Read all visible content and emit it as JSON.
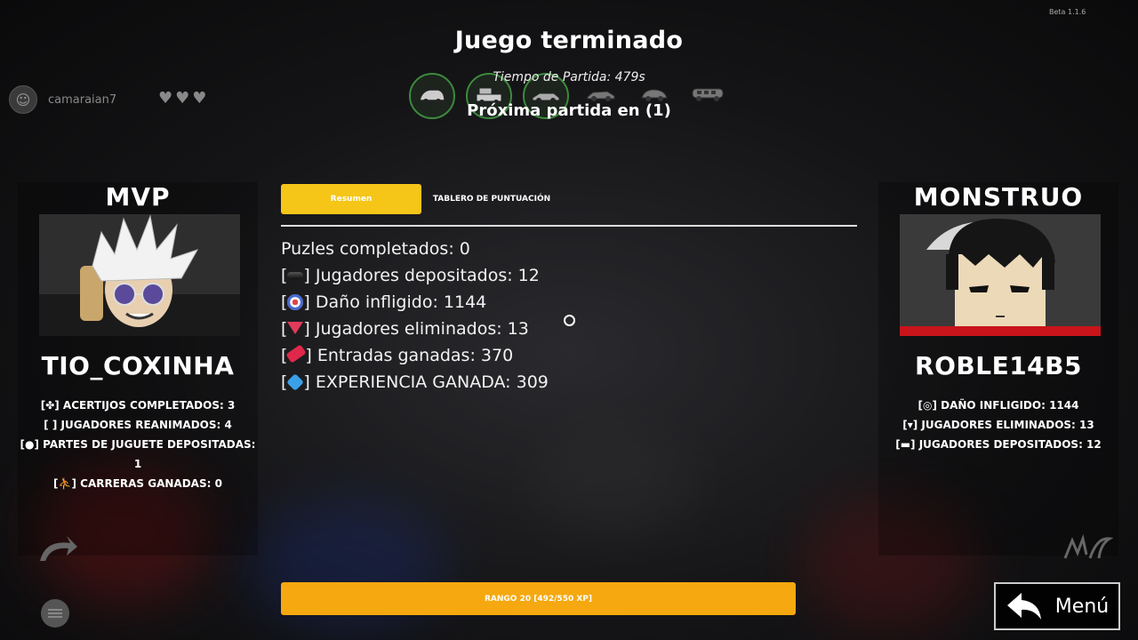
{
  "beta_label": "Beta 1.1.6",
  "title": "Juego terminado",
  "match_time": "Tiempo de Partida: 479s",
  "next_match": "Próxima partida en (1)",
  "user": {
    "name": "camaraian7",
    "lives": 3
  },
  "items": [
    {
      "icon": "toy-car-icon",
      "owned": true
    },
    {
      "icon": "toy-truck-icon",
      "owned": true
    },
    {
      "icon": "toy-racecar-icon",
      "owned": true
    },
    {
      "icon": "toy-sportscar-icon",
      "owned": false
    },
    {
      "icon": "toy-coupe-icon",
      "owned": false
    },
    {
      "icon": "toy-bus-icon",
      "owned": false
    }
  ],
  "mvp": {
    "heading": "MVP",
    "player": "TIO_COXINHA",
    "stats": [
      "[✤] ACERTIJOS COMPLETADOS: 3",
      "[ ] JUGADORES REANIMADOS: 4",
      "[●] PARTES DE JUGUETE DEPOSITADAS: 1",
      "[⛹] CARRERAS GANADAS: 0"
    ]
  },
  "monster": {
    "heading": "MONSTRUO",
    "player": "ROBLE14B5",
    "stats": [
      "[◎] DAÑO INFLIGIDO: 1144",
      "[▾] JUGADORES ELIMINADOS: 13",
      "[▬] JUGADORES DEPOSITADOS: 12"
    ]
  },
  "tabs": {
    "summary": "Resumen",
    "scoreboard": "TABLERO DE PUNTUACIÓN"
  },
  "summary": {
    "puzzles": "Puzles completados: 0",
    "deposited": "Jugadores depositados: 12",
    "damage": "Daño infligido: 1144",
    "eliminated": "Jugadores eliminados: 13",
    "tickets": "Entradas ganadas: 370",
    "xp": "EXPERIENCIA GANADA: 309"
  },
  "rank_label": "RANGO 20 [492/550 XP]",
  "rank_progress": 0.894,
  "menu_label": "Menú",
  "colors": {
    "accent_yellow": "#f5c518",
    "rank_orange": "#f5a80f",
    "owned_ring": "#3d8a3d"
  }
}
